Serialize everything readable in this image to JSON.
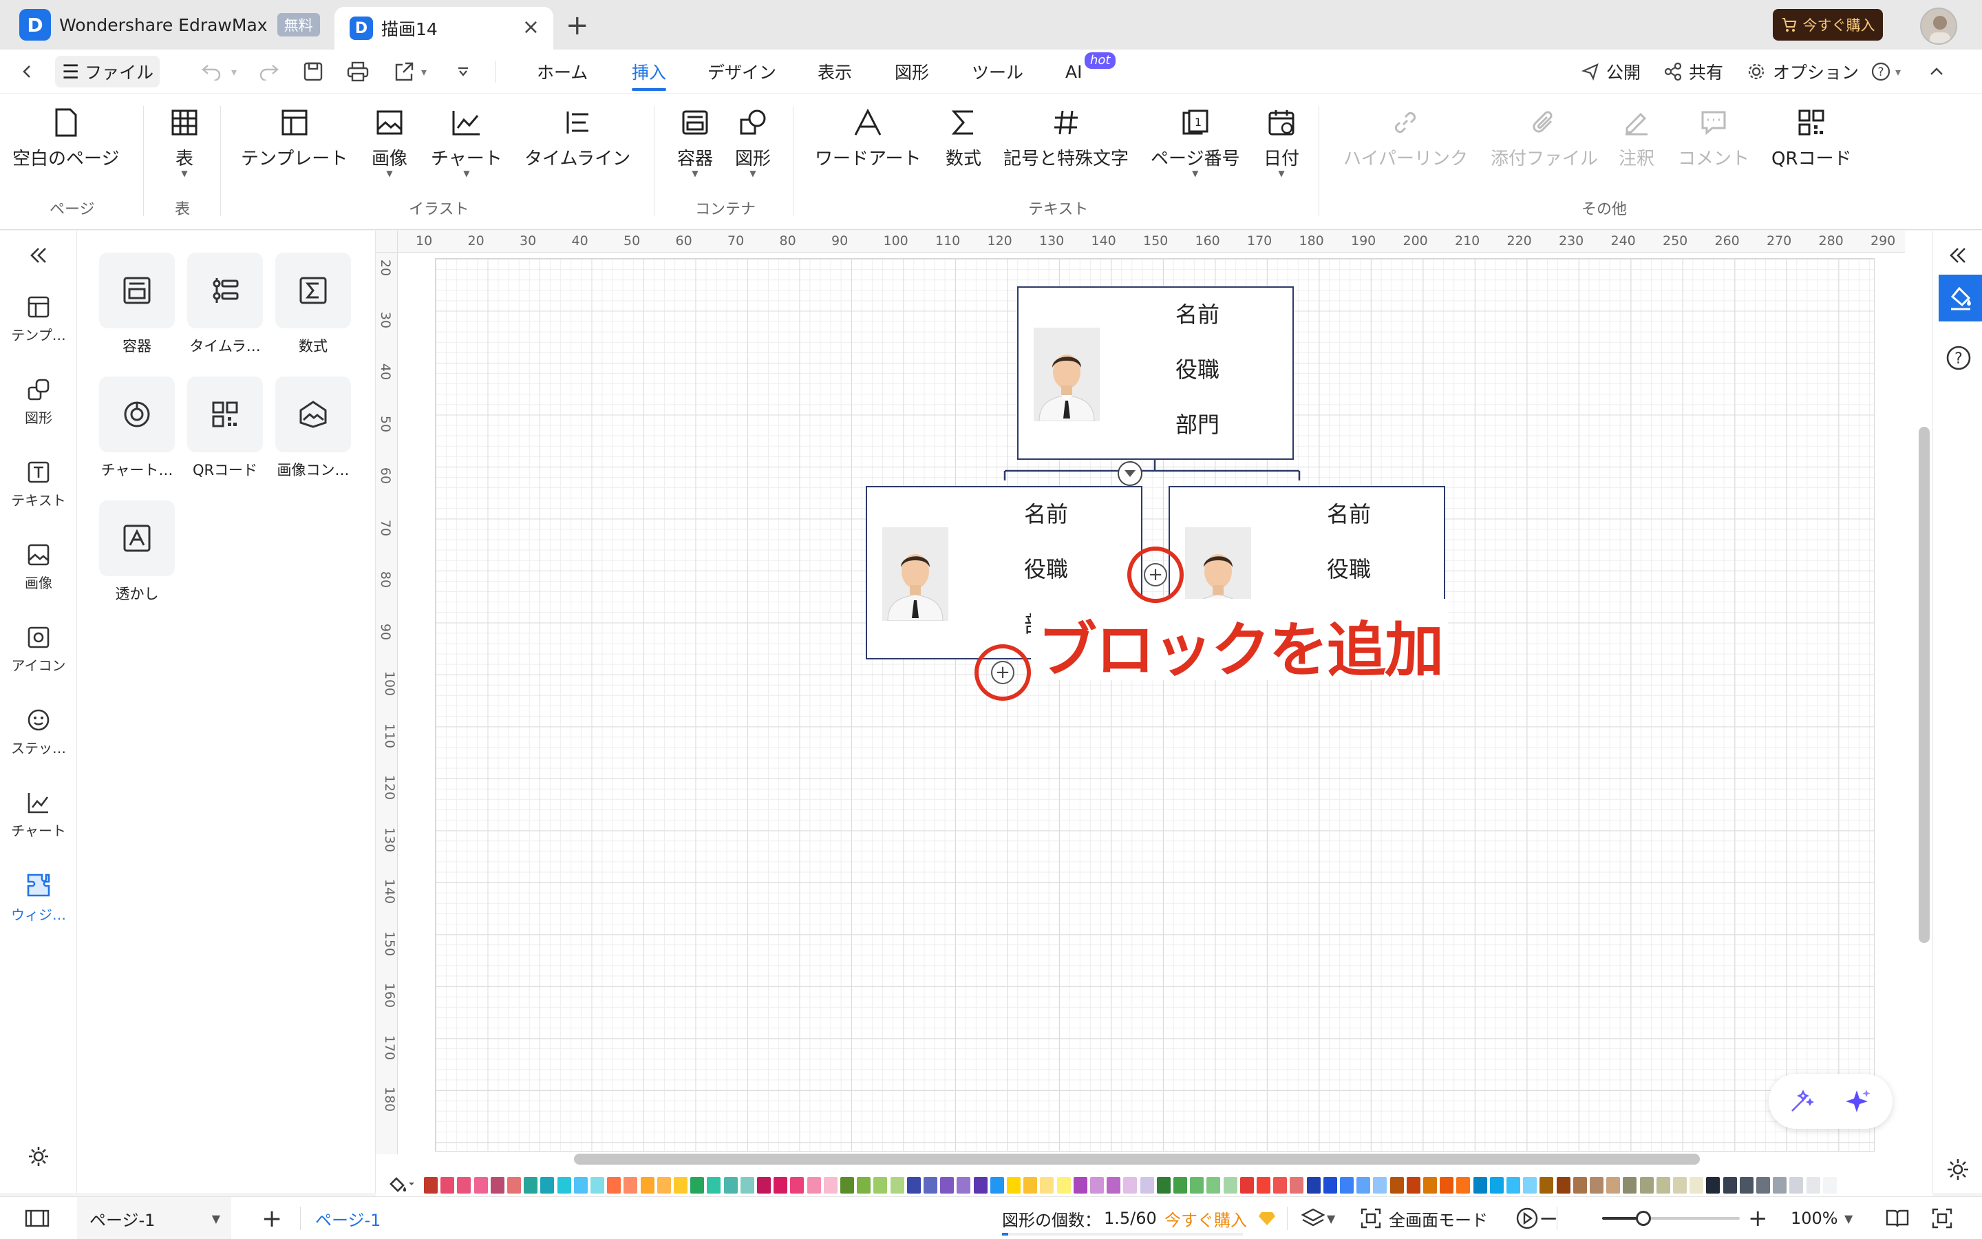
{
  "window": {
    "app_tab_title": "Wondershare EdrawMax",
    "free_badge": "無料",
    "doc_tab_title": "描画14",
    "buy_button": "今すぐ購入"
  },
  "menu": {
    "file": "ファイル",
    "items": [
      "ホーム",
      "挿入",
      "デザイン",
      "表示",
      "図形",
      "ツール",
      "AI"
    ],
    "active_item": "挿入",
    "ai_badge": "hot",
    "publish": "公開",
    "share": "共有",
    "options": "オプション"
  },
  "ribbon": {
    "buttons": {
      "blank_page": "空白のページ",
      "table": "表",
      "template": "テンプレート",
      "image": "画像",
      "chart": "チャート",
      "timeline": "タイムライン",
      "container": "容器",
      "shape": "図形",
      "wordart": "ワードアート",
      "formula": "数式",
      "symbols": "記号と特殊文字",
      "page_number": "ページ番号",
      "date": "日付",
      "hyperlink": "ハイパーリンク",
      "attachment": "添付ファイル",
      "note": "注釈",
      "comment": "コメント",
      "qrcode": "QRコード"
    },
    "groups": {
      "page": "ページ",
      "table": "表",
      "illustration": "イラスト",
      "container": "コンテナ",
      "text": "テキスト",
      "other": "その他"
    }
  },
  "left_rail": [
    {
      "label": "テンプ…",
      "icon": "template-icon"
    },
    {
      "label": "図形",
      "icon": "shapes-icon"
    },
    {
      "label": "テキスト",
      "icon": "text-icon"
    },
    {
      "label": "画像",
      "icon": "image-icon"
    },
    {
      "label": "アイコン",
      "icon": "icon-library-icon"
    },
    {
      "label": "ステッ…",
      "icon": "sticker-icon"
    },
    {
      "label": "チャート",
      "icon": "chart-icon"
    },
    {
      "label": "ウィジ…",
      "icon": "widget-icon",
      "active": true
    }
  ],
  "panel_tiles": [
    "容器",
    "タイムラ…",
    "数式",
    "チャート…",
    "QRコード",
    "画像コン…",
    "透かし"
  ],
  "ruler": {
    "top": [
      "10",
      "20",
      "30",
      "40",
      "50",
      "60",
      "70",
      "80",
      "90",
      "100",
      "110",
      "120",
      "130",
      "140",
      "150",
      "160",
      "170",
      "180",
      "190",
      "200",
      "210",
      "220",
      "230",
      "240",
      "250",
      "260",
      "270",
      "280",
      "290"
    ],
    "left": [
      "20",
      "30",
      "40",
      "50",
      "60",
      "70",
      "80",
      "90",
      "100",
      "110",
      "120",
      "130",
      "140",
      "150",
      "160",
      "170",
      "180"
    ]
  },
  "org_chart": {
    "top_card": {
      "name": "名前",
      "title": "役職",
      "dept": "部門"
    },
    "left_card": {
      "name": "名前",
      "title": "役職",
      "dept": "部"
    },
    "right_card": {
      "name": "名前",
      "title": "役職"
    }
  },
  "annotation": "ブロックを追加",
  "colors": {
    "accent": "#1e73e8",
    "annotation_red": "#e0301e",
    "card_border": "#2d3a6b",
    "palette": [
      "#c0392b",
      "#e74c6f",
      "#e8557a",
      "#f06292",
      "#ba4a6e",
      "#e57373",
      "#26a69a",
      "#1ba5b8",
      "#26c6da",
      "#4fc3f7",
      "#80deea",
      "#ff7043",
      "#ff8a65",
      "#ffa726",
      "#ffb74d",
      "#ffca28",
      "#26a65b",
      "#2ec4a5",
      "#4db6ac",
      "#80cbc4",
      "#c2185b",
      "#d81b60",
      "#ec407a",
      "#f48fb1",
      "#f8bbd0",
      "#5b8c2a",
      "#7cb342",
      "#9ccc65",
      "#aed581",
      "#3949ab",
      "#5c6bc0",
      "#7e57c2",
      "#9575cd",
      "#5e35b1",
      "#2196f3",
      "#ffd600",
      "#fbc02d",
      "#ffe082",
      "#fff176",
      "#ab47bc",
      "#ce93d8",
      "#ba68c8",
      "#e1bee7",
      "#d1c4e9",
      "#2e7d32",
      "#43a047",
      "#66bb6a",
      "#81c784",
      "#a5d6a7",
      "#e53935",
      "#f44336",
      "#ef5350",
      "#e57373",
      "#1e40af",
      "#1d4ed8",
      "#3b82f6",
      "#60a5fa",
      "#93c5fd",
      "#b45309",
      "#c2410c",
      "#d97706",
      "#ea580c",
      "#f97316",
      "#0284c7",
      "#0ea5e9",
      "#38bdf8",
      "#7dd3fc",
      "#a16207",
      "#92400e",
      "#a8754b",
      "#b08968",
      "#c9a27e",
      "#8d8d6e",
      "#a3a380",
      "#bdbd96",
      "#d6d2b0",
      "#ece8d0",
      "#1f2937",
      "#374151",
      "#4b5563",
      "#6b7280",
      "#9ca3af",
      "#d1d5db",
      "#e5e7eb",
      "#f3f4f6"
    ]
  },
  "statusbar": {
    "page_selector": "ページ-1",
    "page_tab": "ページ-1",
    "shape_count_label": "図形の個数：",
    "shape_count": "1.5/60",
    "buy_link": "今すぐ購入",
    "fullscreen": "全画面モード",
    "zoom": "100%",
    "zoom_level": 0.3
  }
}
